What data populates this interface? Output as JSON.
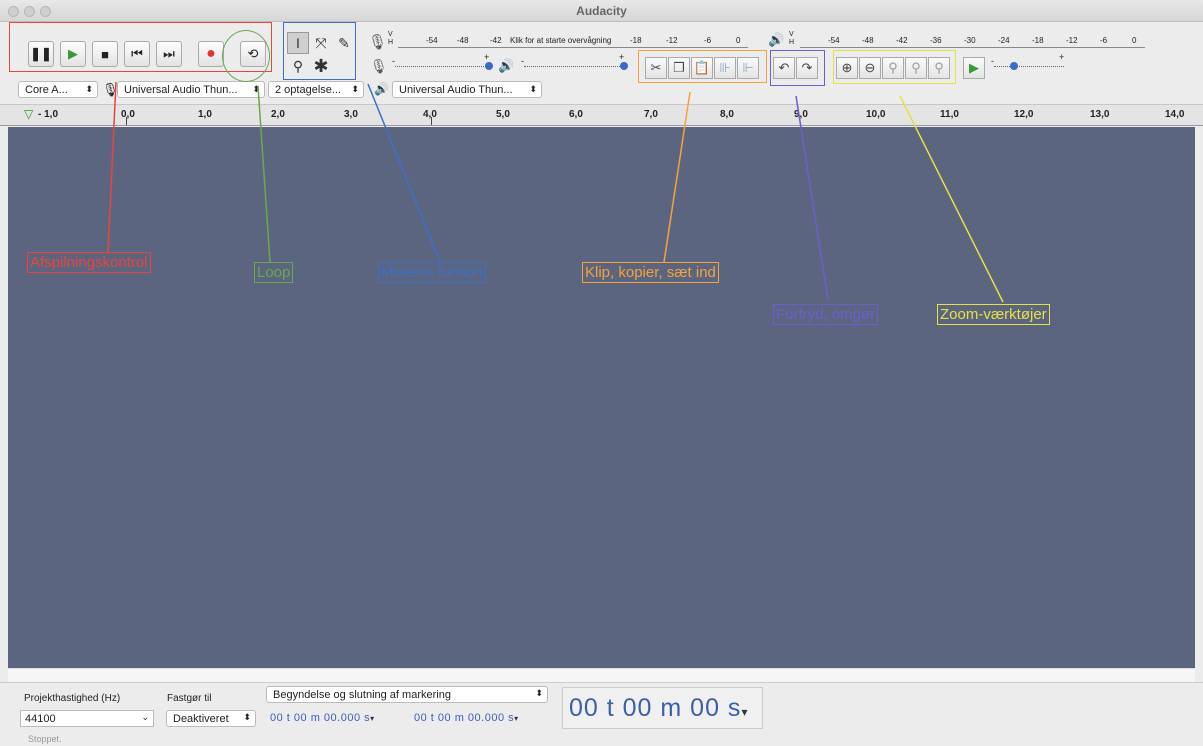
{
  "window": {
    "title": "Audacity"
  },
  "transport": {
    "pause": "pause-icon",
    "play": "play-icon",
    "stop": "stop-icon",
    "skip_start": "skip-start-icon",
    "skip_end": "skip-end-icon",
    "record": "record-icon",
    "loop": "loop-icon"
  },
  "tools": {
    "select": "I",
    "envelope": "⤧",
    "draw": "✎",
    "zoom": "⚲",
    "multi": "✱"
  },
  "meters": {
    "record_scale": [
      "-54",
      "-48",
      "-42",
      "Klik for at starte overvågning",
      "-18",
      "-12",
      "-6",
      "0"
    ],
    "play_scale": [
      "-54",
      "-48",
      "-42",
      "-36",
      "-30",
      "-24",
      "-18",
      "-12",
      "-6",
      "0"
    ],
    "l_label": "V",
    "r_label": "H"
  },
  "sliders": {
    "record_min": "-",
    "record_max": "+",
    "play_min": "-",
    "play_max": "+"
  },
  "devices": {
    "host": "Core A...",
    "record_device": "Universal Audio Thun...",
    "channels": "2 optagelse...",
    "playback_device": "Universal Audio Thun..."
  },
  "ruler": {
    "ticks": [
      "- 1,0",
      "0,0",
      "1,0",
      "2,0",
      "3,0",
      "4,0",
      "5,0",
      "6,0",
      "7,0",
      "8,0",
      "9,0",
      "10,0",
      "11,0",
      "12,0",
      "13,0",
      "14,0"
    ]
  },
  "annotations": {
    "playback": "Afspilningskontrol",
    "loop": "Loop",
    "mouse": "Musens funtion",
    "clip": "Klip, kopier, sæt ind",
    "undo": "Fortryd, omgør",
    "zoom": "Zoom-værktøjer"
  },
  "annotation_colors": {
    "playback": "#e8463c",
    "loop": "#6aa84f",
    "mouse": "#3d6fc9",
    "clip": "#f4a23a",
    "undo": "#6a5fd0",
    "zoom": "#e6e043"
  },
  "bottom": {
    "rate_label": "Projekthastighed (Hz)",
    "rate_value": "44100",
    "snap_label": "Fastgør til",
    "snap_value": "Deaktiveret",
    "selection_mode": "Begyndelse og slutning af markering",
    "sel_start": "00 t 00 m 00.000 s",
    "sel_end": "00 t 00 m 00.000 s",
    "audio_position": "00 t 00 m 00 s"
  },
  "status": {
    "text": "Stoppet."
  }
}
